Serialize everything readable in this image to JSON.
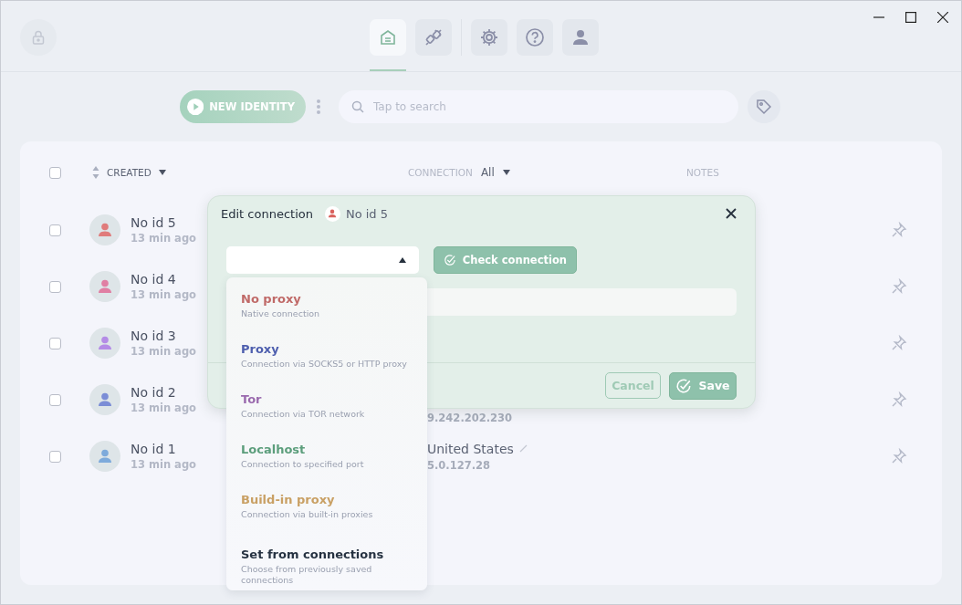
{
  "nav": [
    {
      "selected": true
    },
    {
      "selected": false
    },
    {
      "selected": false
    },
    {
      "selected": false
    },
    {
      "selected": false
    }
  ],
  "toolbar": {
    "new_identity": "NEW IDENTITY",
    "search": {
      "placeholder": "Tap to search"
    }
  },
  "table": {
    "select_all": {
      "checked": false
    },
    "columns": {
      "created": "CREATED",
      "connection": "CONNECTION",
      "connection_filter": "All",
      "notes": "NOTES"
    },
    "rows": [
      {
        "name": "No id 5",
        "time": "13 min ago",
        "color": "#e07b7b",
        "checked": false
      },
      {
        "name": "No id 4",
        "time": "13 min ago",
        "color": "#e07fa3",
        "checked": false
      },
      {
        "name": "No id 3",
        "time": "13 min ago",
        "color": "#b48be6",
        "checked": false
      },
      {
        "name": "No id 2",
        "time": "13 min ago",
        "color": "#7b8dd6",
        "checked": false,
        "ip": "9.242.202.230"
      },
      {
        "name": "No id 1",
        "time": "13 min ago",
        "color": "#7eaadb",
        "checked": false,
        "country": "United States",
        "ip": "5.0.127.28"
      }
    ]
  },
  "dialog": {
    "title": "Edit connection",
    "identity": "No id 5",
    "check_button": "Check connection",
    "cancel": "Cancel",
    "save": "Save",
    "options": [
      {
        "kind": "type",
        "name": "No proxy",
        "description": "Native connection",
        "color": "#c06a68"
      },
      {
        "kind": "type",
        "name": "Proxy",
        "description": "Connection via SOCKS5 or HTTP proxy",
        "color": "#4e5fae"
      },
      {
        "kind": "type",
        "name": "Tor",
        "description": "Connection via TOR network",
        "color": "#9a6aae"
      },
      {
        "kind": "type",
        "name": "Localhost",
        "description": "Connection to specified port",
        "color": "#5c9e7c"
      },
      {
        "kind": "type",
        "name": "Build-in proxy",
        "description": "Connection via built-in proxies",
        "color": "#c9a064"
      },
      {
        "kind": "saved",
        "name": "Set from connections",
        "description": "Choose from previously saved connections",
        "color": "#263241"
      }
    ]
  }
}
